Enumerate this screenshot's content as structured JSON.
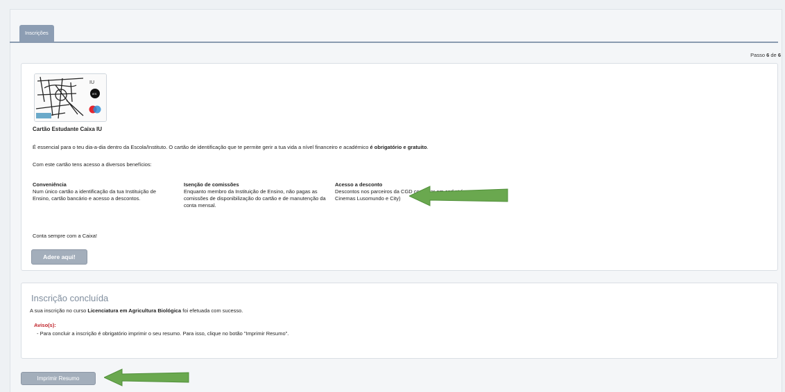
{
  "tabs": [
    {
      "label": "Inscrições"
    }
  ],
  "step": {
    "prefix": "Passo",
    "current": "6",
    "sep": "de",
    "total": "6"
  },
  "card_promo": {
    "title": "Cartão Estudante Caixa IU",
    "intro_pre": "É essencial para o teu dia-a-dia dentro da Escola/Instituto. O cartão de identificação que te permite gerir a tua vida a nível financeiro e académico ",
    "intro_bold": "é obrigatório e gratuito",
    "intro_post": ".",
    "benefits_intro": "Com este cartão tens acesso a diversos benefícios:",
    "benefits": [
      {
        "title": "Conveniência",
        "text": "Num único cartão a identificação da tua Instituição de Ensino, cartão bancário e acesso a descontos."
      },
      {
        "title": "Isenção de comissões",
        "text": "Enquanto membro da Instituição de Ensino, não pagas as comissões de disponibilização do cartão e de manutenção da conta mensal."
      },
      {
        "title": "Acesso a desconto",
        "text": "Descontos nos parceiros da CGD consultar em cgd.pt (ex: Cinemas Lusomundo e City)"
      }
    ],
    "closing": "Conta sempre com a Caixa!",
    "button_label": "Adere aqui!",
    "image_marks": {
      "brand": "IU",
      "badge": "IES"
    }
  },
  "enrollment": {
    "title": "Inscrição concluída",
    "text_pre": "A sua inscrição no curso ",
    "course": "Licenciatura em Agricultura Biológica",
    "text_post": " foi efetuada com sucesso.",
    "warning_label": "Aviso(s):",
    "warning_text": "- Para concluir a inscrição é obrigatório imprimir o seu resumo. Para isso, clique no botão \"Imprimir Resumo\"."
  },
  "print_button_label": "Imprimir Resumo",
  "colors": {
    "arrow": "#6aa84f",
    "tab": "#8c9db3",
    "button": "#a3aebb",
    "warning": "#c0242b",
    "title_muted": "#7f8d9d"
  },
  "icons": {
    "arrow": "arrow-left-icon",
    "card": "student-card-image"
  }
}
